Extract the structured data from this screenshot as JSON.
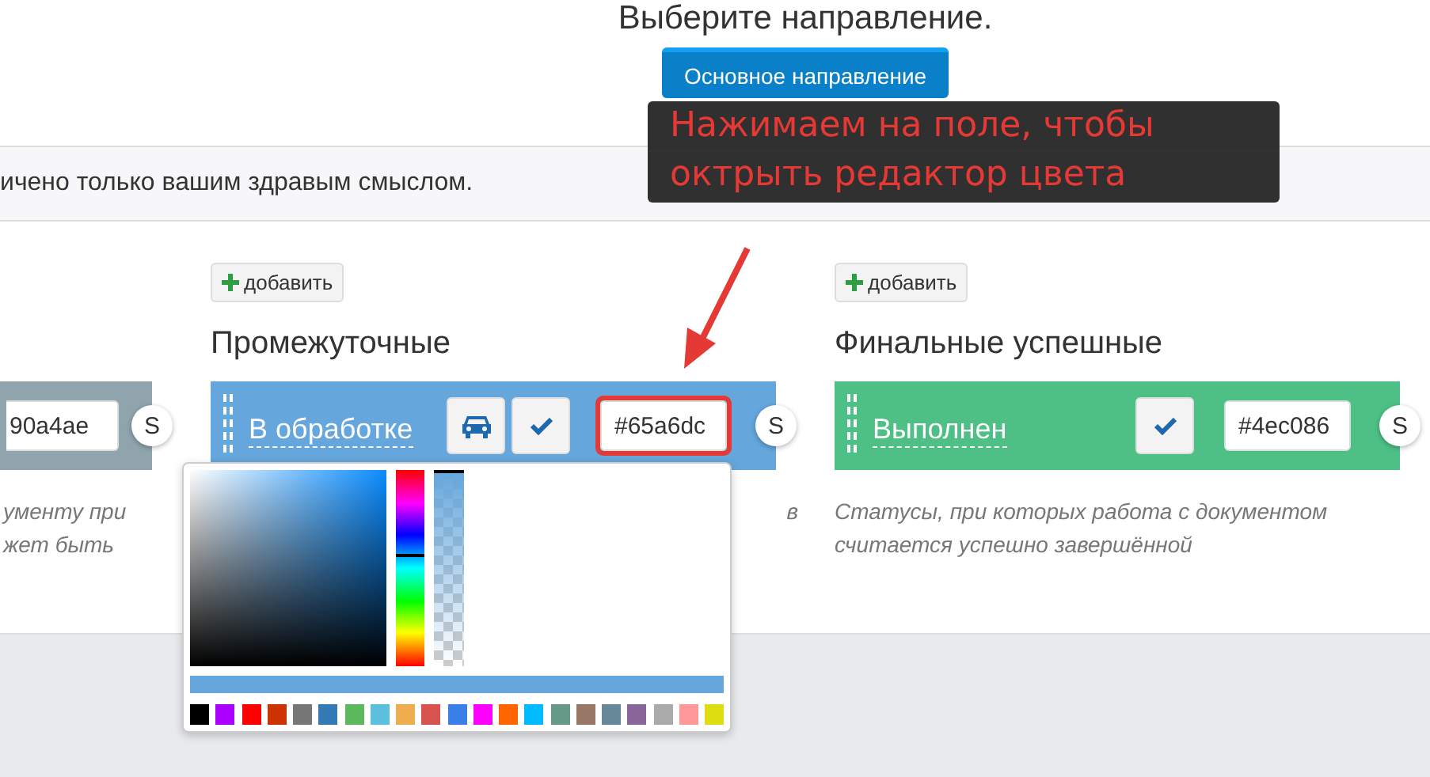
{
  "header": {
    "title": "Выберите направление.",
    "button": "Основное направление"
  },
  "notice": "ичено только вашим здравым смыслом.",
  "columns": [
    {
      "kind": "partial",
      "statuses": [
        {
          "color": "#90a4ae",
          "value": "90a4ae",
          "car": false,
          "check": false,
          "highlighted": false,
          "badge": "S"
        }
      ],
      "description": [
        "ументу при",
        "жет быть"
      ]
    },
    {
      "kind": "full",
      "add_button": "добавить",
      "title": "Промежуточные",
      "statuses": [
        {
          "name": "В обработке",
          "color": "#65a6dc",
          "value": "#65a6dc",
          "car": true,
          "check": true,
          "highlighted": true,
          "badge": "S"
        }
      ],
      "description": [
        "в"
      ]
    },
    {
      "kind": "full",
      "add_button": "добавить",
      "title": "Финальные успешные",
      "statuses": [
        {
          "name": "Выполнен",
          "color": "#4ec086",
          "value": "#4ec086",
          "car": false,
          "check": true,
          "highlighted": false,
          "badge": "S"
        }
      ],
      "description": [
        "Статусы, при которых работа с документом",
        "считается успешно завершённой"
      ]
    }
  ],
  "picker": {
    "hue": {
      "level": 0.56
    },
    "alpha": {
      "level": 1
    },
    "swatches": [
      {
        "color": "#000000"
      },
      {
        "color": "#aa00ff"
      },
      {
        "color": "#ff0000"
      },
      {
        "color": "#cc3300"
      },
      {
        "color": "#777777"
      },
      {
        "color": "#337ab7"
      },
      {
        "color": "#5cb85c"
      },
      {
        "color": "#5bc0de"
      },
      {
        "color": "#f0ad4e"
      },
      {
        "color": "#d9534f"
      },
      {
        "color": "#3a80e8"
      },
      {
        "color": "#ff00ff"
      },
      {
        "color": "#ff6600"
      },
      {
        "color": "#00bbff"
      },
      {
        "color": "#669988"
      },
      {
        "color": "#997766"
      },
      {
        "color": "#668899"
      },
      {
        "color": "#886699"
      },
      {
        "color": "#aaaaaa"
      },
      {
        "color": "#ff9999"
      },
      {
        "color": "#dddd11"
      }
    ]
  },
  "tooltip": {
    "text": "Нажимаем на поле, чтобы октрыть редактор цвета"
  }
}
